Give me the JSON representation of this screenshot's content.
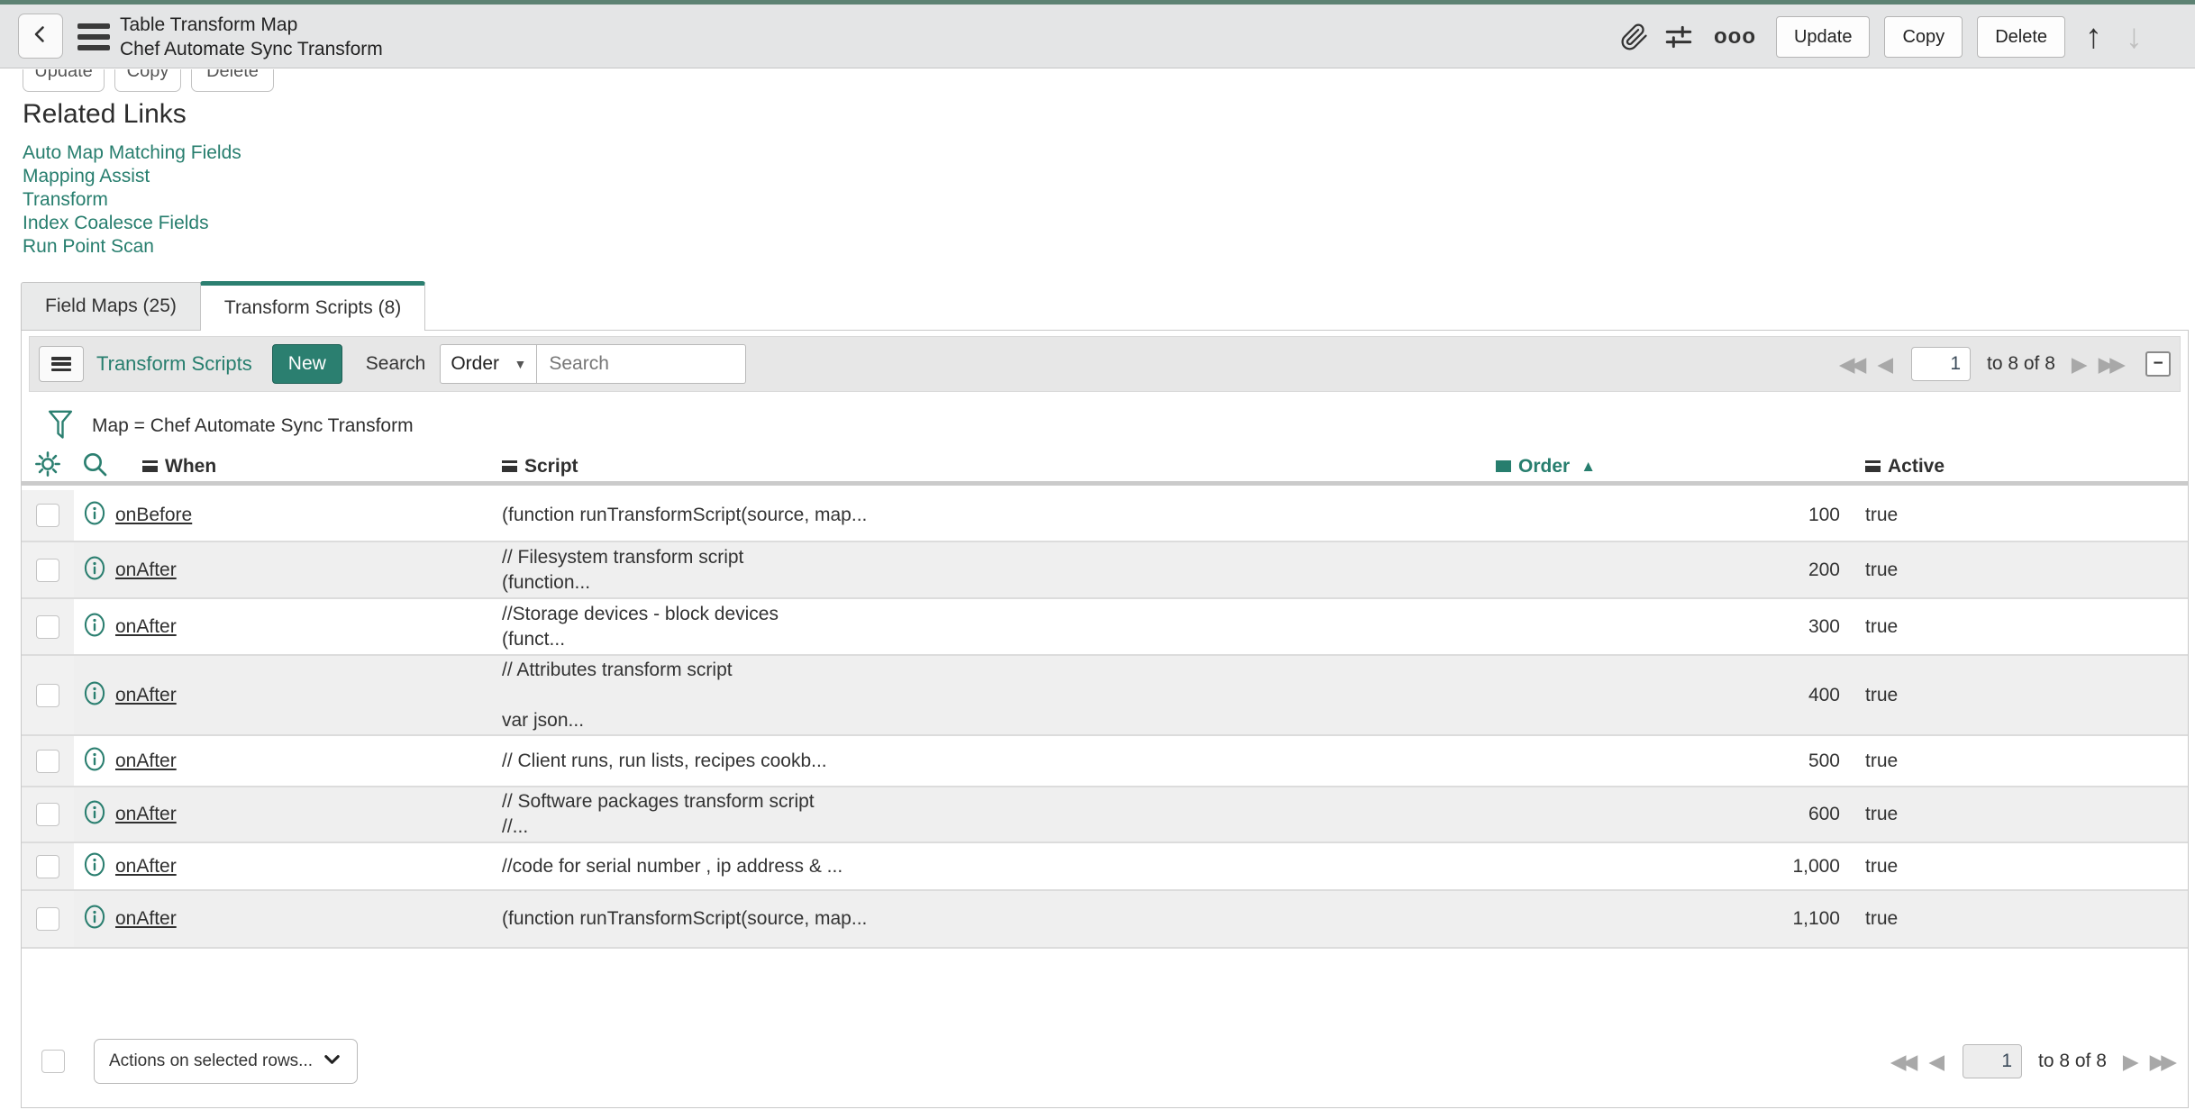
{
  "header": {
    "title_line1": "Table Transform Map",
    "title_line2": "Chef Automate Sync Transform",
    "update_label": "Update",
    "copy_label": "Copy",
    "delete_label": "Delete"
  },
  "clipped_buttons": {
    "first": "Update",
    "second": "Copy",
    "third": "Delete"
  },
  "related": {
    "heading": "Related Links",
    "links": {
      "0": "Auto Map Matching Fields",
      "1": "Mapping Assist",
      "2": "Transform",
      "3": "Index Coalesce Fields",
      "4": "Run Point Scan"
    }
  },
  "tabs": {
    "field_maps": "Field Maps (25)",
    "transform_scripts": "Transform Scripts (8)"
  },
  "list": {
    "title": "Transform Scripts",
    "new_label": "New",
    "search_label": "Search",
    "search_column": "Order",
    "search_placeholder": "Search",
    "filter_text": "Map = Chef Automate Sync Transform",
    "columns": {
      "when": "When",
      "script": "Script",
      "order": "Order",
      "active": "Active"
    },
    "sorted_column": "Order",
    "sort_direction": "ascending",
    "pagination": {
      "page": "1",
      "range": "to 8 of 8"
    },
    "footer": {
      "actions_placeholder": "Actions on selected rows...",
      "page": "1",
      "range": "to 8 of 8"
    },
    "rows": [
      {
        "when": "onBefore",
        "script": "(function runTransformScript(source, map...",
        "order": "100",
        "active": "true"
      },
      {
        "when": "onAfter",
        "script": "// Filesystem transform script\n(function...",
        "order": "200",
        "active": "true"
      },
      {
        "when": "onAfter",
        "script": "//Storage devices - block devices\n(funct...",
        "order": "300",
        "active": "true"
      },
      {
        "when": "onAfter",
        "script": "// Attributes transform script\n\nvar json...",
        "order": "400",
        "active": "true"
      },
      {
        "when": "onAfter",
        "script": "// Client runs, run lists, recipes cookb...",
        "order": "500",
        "active": "true"
      },
      {
        "when": "onAfter",
        "script": "// Software packages transform script\n//...",
        "order": "600",
        "active": "true"
      },
      {
        "when": "onAfter",
        "script": "//code for serial number , ip address & ...",
        "order": "1,000",
        "active": "true"
      },
      {
        "when": "onAfter",
        "script": "(function runTransformScript(source, map...",
        "order": "1,100",
        "active": "true"
      }
    ]
  },
  "icons": {
    "first_page": "◀◀",
    "previous_page": "◀",
    "next_page": "▶",
    "last_page": "▶▶",
    "navigate_up": "↑",
    "navigate_down": "↓",
    "sort_ascending": "▲",
    "dropdown_caret": "▼",
    "collapse": "−",
    "more": "ooo"
  },
  "colors": {
    "accent": "#2b7f70",
    "link": "#277e6e",
    "top_strip": "#5d8273",
    "header_bg": "#e4e5e6"
  }
}
